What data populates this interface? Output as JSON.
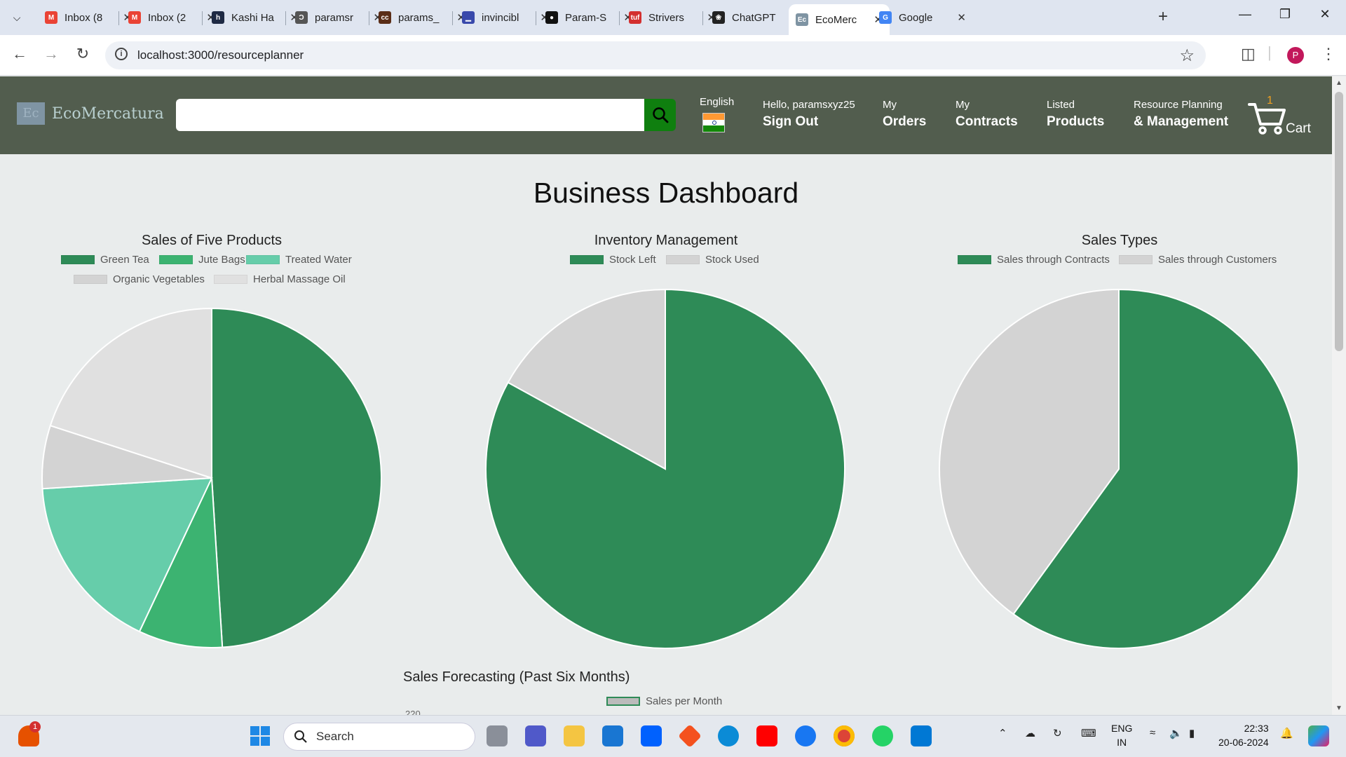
{
  "browser": {
    "tabs": [
      {
        "label": "Inbox (8",
        "fav": "gmail-icon",
        "color": "#ea4335"
      },
      {
        "label": "Inbox (2",
        "fav": "gmail-icon",
        "color": "#ea4335"
      },
      {
        "label": "Kashi Ha",
        "fav": "h-icon",
        "color": "#1f2a44"
      },
      {
        "label": "paramsr",
        "fav": "quill-icon",
        "color": "#555555"
      },
      {
        "label": "params_",
        "fav": "cc-icon",
        "color": "#5a2d17"
      },
      {
        "label": "invincibl",
        "fav": "bars-icon",
        "color": "#3949ab"
      },
      {
        "label": "Param-S",
        "fav": "github-icon",
        "color": "#111111"
      },
      {
        "label": "Strivers",
        "fav": "tuf-icon",
        "color": "#d32f2f"
      },
      {
        "label": "ChatGPT",
        "fav": "openai-icon",
        "color": "#222222"
      },
      {
        "label": "EcoMerc",
        "fav": "ec-icon",
        "color": "#7f94a3",
        "active": true
      },
      {
        "label": "Google",
        "fav": "google-icon",
        "color": "#4285f4"
      }
    ],
    "url": "localhost:3000/resourceplanner",
    "profile_initial": "P"
  },
  "header": {
    "logo_mark": "Ec",
    "logo_text": "EcoMercatura",
    "search_placeholder": "",
    "language": "English",
    "greeting": "Hello, paramsxyz25",
    "signout": "Sign Out",
    "nav": [
      {
        "small": "My",
        "big": "Orders"
      },
      {
        "small": "My",
        "big": "Contracts"
      },
      {
        "small": "Listed",
        "big": "Products"
      },
      {
        "small": "Resource Planning",
        "big": "& Management"
      }
    ],
    "cart_count": "1",
    "cart_label": "Cart"
  },
  "dashboard": {
    "title": "Business Dashboard",
    "forecast_title": "Sales Forecasting (Past Six Months)",
    "forecast_legend": "Sales per Month",
    "forecast_first_tick": "220"
  },
  "chart_data": [
    {
      "type": "pie",
      "title": "Sales of Five Products",
      "categories": [
        "Green Tea",
        "Jute Bags",
        "Treated Water",
        "Organic Vegetables",
        "Herbal Massage Oil"
      ],
      "values": [
        49,
        8,
        17,
        6,
        20
      ],
      "colors": [
        "#2e8b57",
        "#3cb371",
        "#66cdaa",
        "#d3d3d3",
        "#e0e0e0"
      ],
      "legend": "top"
    },
    {
      "type": "pie",
      "title": "Inventory Management",
      "categories": [
        "Stock Left",
        "Stock Used"
      ],
      "values": [
        83,
        17
      ],
      "colors": [
        "#2e8b57",
        "#d3d3d3"
      ],
      "legend": "top"
    },
    {
      "type": "pie",
      "title": "Sales Types",
      "categories": [
        "Sales through Contracts",
        "Sales through Customers"
      ],
      "values": [
        60,
        40
      ],
      "colors": [
        "#2e8b57",
        "#d3d3d3"
      ],
      "legend": "top"
    }
  ],
  "taskbar": {
    "search_label": "Search",
    "lang_line1": "ENG",
    "lang_line2": "IN",
    "time": "22:33",
    "date": "20-06-2024",
    "notification_count": "1"
  }
}
